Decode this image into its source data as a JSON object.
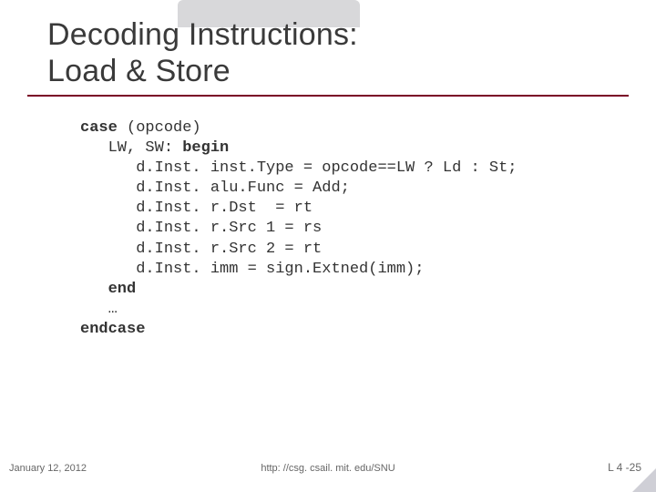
{
  "title_line1": "Decoding Instructions:",
  "title_line2": "Load & Store",
  "code": {
    "l1a": "case",
    "l1b": " (opcode)",
    "l2a": "   LW, SW: ",
    "l2b": "begin",
    "l3": "      d.Inst. inst.Type = opcode==LW ? Ld : St;",
    "l4": "      d.Inst. alu.Func = Add;",
    "l5": "      d.Inst. r.Dst  = rt",
    "l6": "      d.Inst. r.Src 1 = rs",
    "l7": "      d.Inst. r.Src 2 = rt",
    "l8": "      d.Inst. imm = sign.Extned(imm);",
    "l9": "   end",
    "l10": "   …",
    "l11": "endcase"
  },
  "footer": {
    "date": "January 12, 2012",
    "url": "http: //csg. csail. mit. edu/SNU",
    "page": "L 4 -25"
  }
}
